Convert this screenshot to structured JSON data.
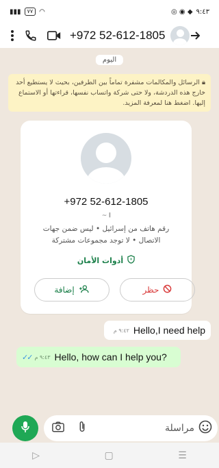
{
  "status_bar": {
    "time": "٩:٤٣",
    "battery": "٧٧"
  },
  "header": {
    "phone_number": "+972 52-612-1805"
  },
  "chat": {
    "day_label": "اليوم",
    "encryption_notice": "الرسائل والمكالمات مشفرة تماماً بين الطرفين، بحيث لا يستطيع أحد خارج هذه الدردشة، ولا حتى شركة واتساب نفسها، قراءتها أو الاستماع إليها. اضغط هنا لمعرفة المزيد.",
    "contact_card": {
      "number": "+972 52-612-1805",
      "name": "~ 𝄂",
      "info": "رقم هاتف من إسرائيل • ليس ضمن جهات الاتصال • لا توجد مجموعات مشتركة",
      "safety_tools": "أدوات الأمان",
      "block_label": "حظر",
      "add_label": "إضافة"
    },
    "messages": [
      {
        "text": "Hello,I need help",
        "time": "٩:٤٢ م",
        "direction": "in"
      },
      {
        "text": "Hello, how can I help you?",
        "time": "٩:٤٣ م",
        "direction": "out"
      }
    ]
  },
  "composer": {
    "placeholder": "مراسلة"
  },
  "colors": {
    "accent_green": "#1fa855",
    "outgoing_bubble": "#d8fdd2",
    "notice_bg": "#fdf3c5",
    "block_red": "#d93b3b"
  },
  "icons": [
    "more-vert-icon",
    "phone-icon",
    "video-icon",
    "back-arrow-icon",
    "lock-icon",
    "shield-icon",
    "block-icon",
    "add-person-icon",
    "mic-icon",
    "camera-icon",
    "attach-icon",
    "emoji-icon",
    "double-check-icon"
  ]
}
